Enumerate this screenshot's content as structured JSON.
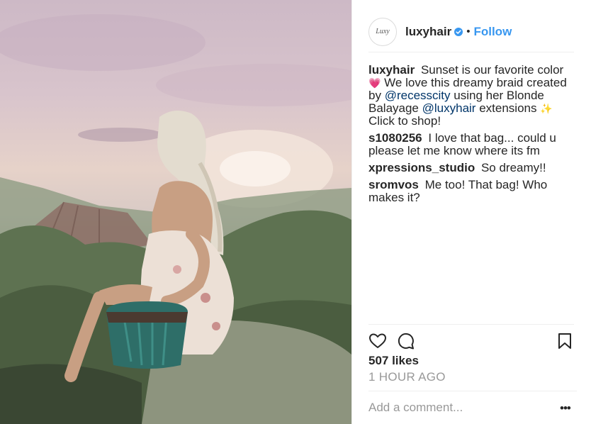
{
  "post": {
    "image_description_icon": "photo-icon"
  },
  "header": {
    "avatar_text": "Luxy",
    "username": "luxyhair",
    "separator": "•",
    "follow_label": "Follow"
  },
  "caption": {
    "user": "luxyhair",
    "text_1": "Sunset is our favorite color",
    "emoji_1": "💗",
    "text_2": "We love this dreamy braid created by",
    "mention_1": "@recesscity",
    "text_3": "using her Blonde Balayage",
    "mention_2": "@luxyhair",
    "text_4": "extensions",
    "emoji_2": "✨",
    "text_5": "Click to shop!"
  },
  "comments": [
    {
      "user": "s1080256",
      "text": "I love that bag... could u please let me know where its fm"
    },
    {
      "user": "xpressions_studio",
      "text": "So dreamy!!"
    },
    {
      "user": "sromvos",
      "text": "Me too! That bag! Who makes it?"
    }
  ],
  "actions": {
    "likes": "507 likes",
    "time": "1 HOUR AGO"
  },
  "add_comment": {
    "placeholder": "Add a comment...",
    "more_label": "•••"
  },
  "colors": {
    "link": "#3897f0",
    "mention": "#003569",
    "muted": "#999999",
    "text": "#262626"
  }
}
